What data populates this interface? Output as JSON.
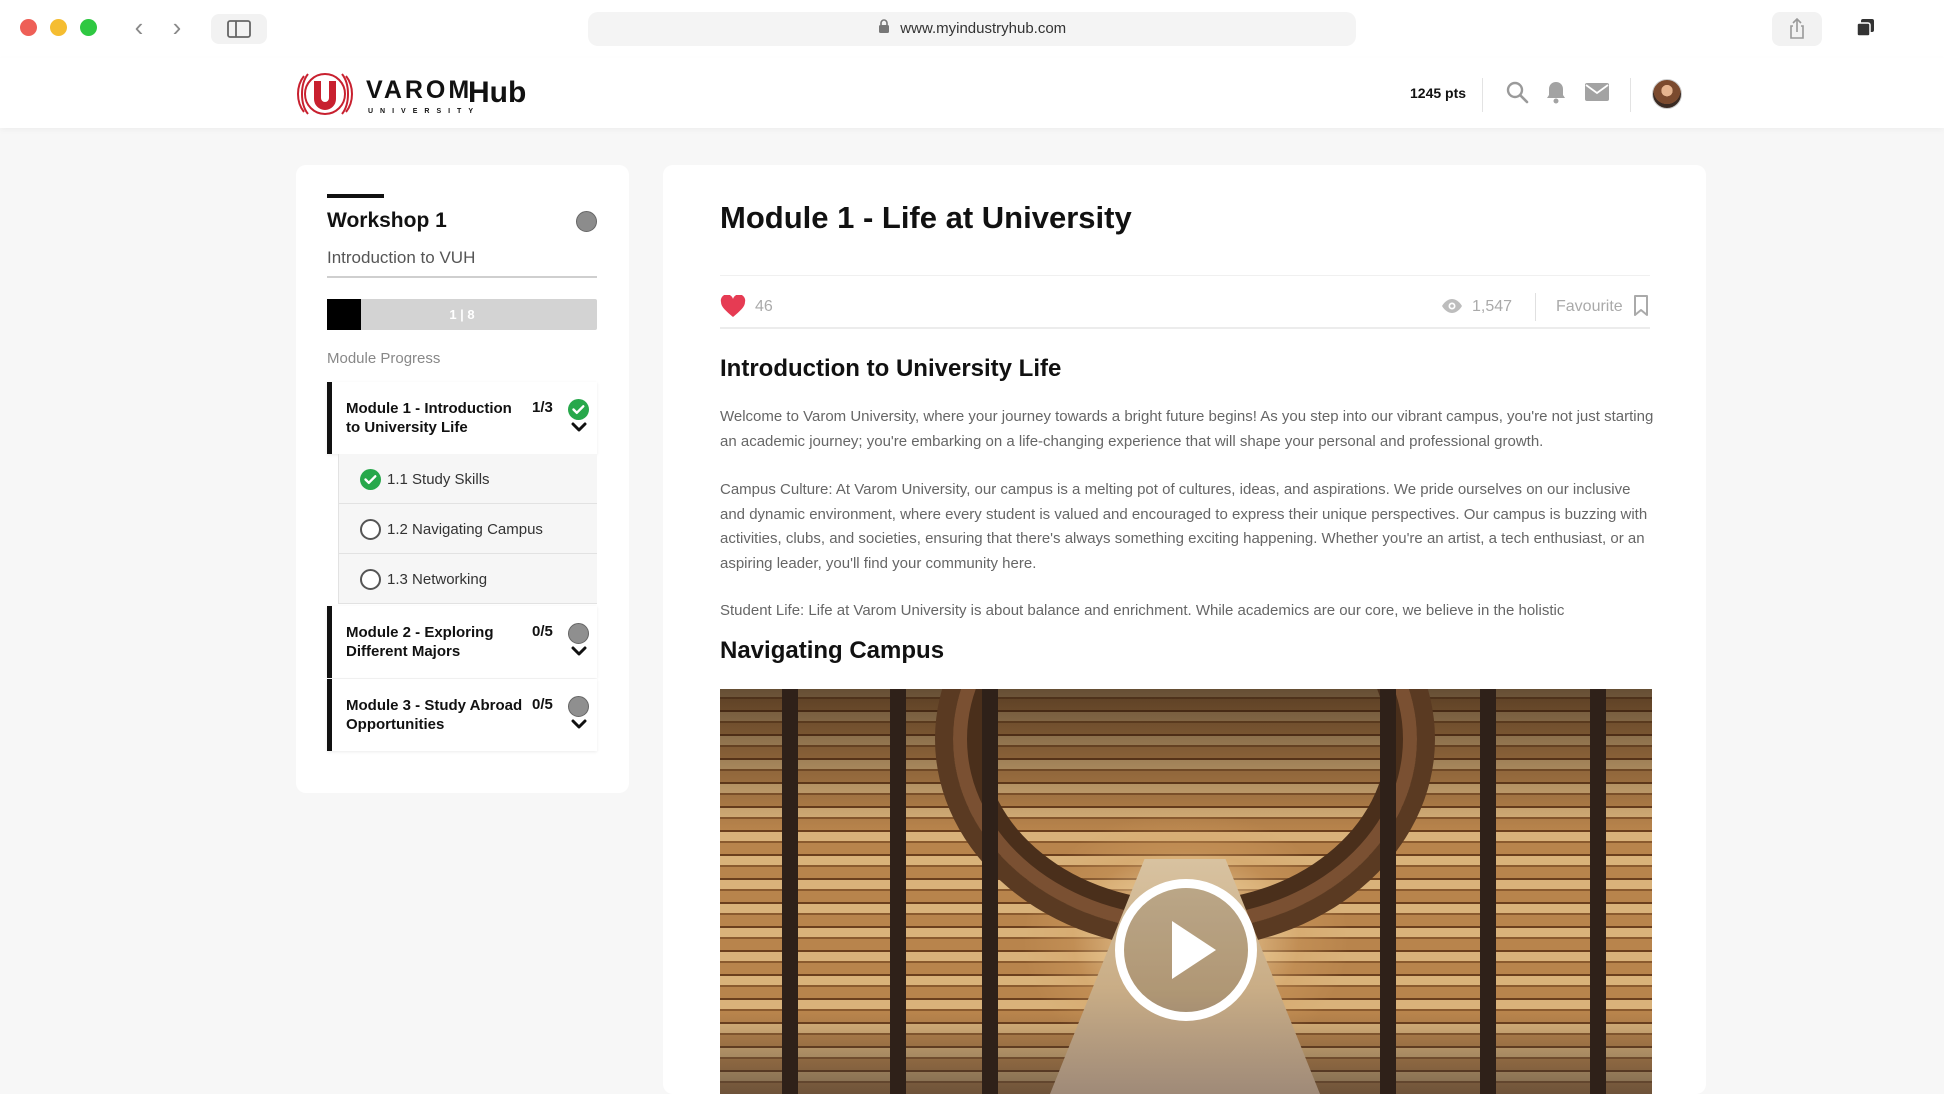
{
  "browser": {
    "url": "www.myindustryhub.com"
  },
  "header": {
    "brand": "VAROM",
    "brand_sub": "UNIVERSITY",
    "hub": "Hub",
    "points": "1245 pts",
    "icons": [
      "search-icon",
      "bell-icon",
      "mail-icon",
      "avatar"
    ]
  },
  "sidebar": {
    "workshop_title": "Workshop 1",
    "workshop_subtitle": "Introduction to VUH",
    "progress": {
      "label": "1 | 8",
      "current": 1,
      "total": 8
    },
    "progress_caption": "Module Progress",
    "modules": [
      {
        "title": "Module 1 - Introduction to University Life",
        "count": "1/3",
        "status": "complete",
        "lessons": [
          {
            "label": "1.1 Study Skills",
            "done": true
          },
          {
            "label": "1.2 Navigating Campus",
            "done": false
          },
          {
            "label": "1.3 Networking",
            "done": false
          }
        ]
      },
      {
        "title": "Module 2 - Exploring Different Majors",
        "count": "0/5",
        "status": "incomplete"
      },
      {
        "title": "Module 3 - Study Abroad Opportunities",
        "count": "0/5",
        "status": "incomplete"
      }
    ]
  },
  "main": {
    "title": "Module 1 - Life at University",
    "likes": "46",
    "views": "1,547",
    "favourite_label": "Favourite",
    "section1_heading": "Introduction to University Life",
    "paragraphs": [
      "Welcome to Varom University, where your journey towards a bright future begins! As you step into our vibrant campus, you're not just starting an academic journey; you're embarking on a life-changing experience that will shape your personal and professional growth.",
      "Campus Culture: At Varom University, our campus is a melting pot of cultures, ideas, and aspirations. We pride ourselves on our inclusive and dynamic environment, where every student is valued and encouraged to express their unique perspectives. Our campus is buzzing with activities, clubs, and societies, ensuring that there's always something exciting happening. Whether you're an artist, a tech enthusiast, or an aspiring leader, you'll find your community here.",
      "Student Life: Life at Varom University is about balance and enrichment. While academics are our core, we believe in the holistic"
    ],
    "section2_heading": "Navigating Campus"
  },
  "colors": {
    "accent_red": "#c8202f",
    "heart": "#e63b53",
    "complete_green": "#27a84b"
  }
}
